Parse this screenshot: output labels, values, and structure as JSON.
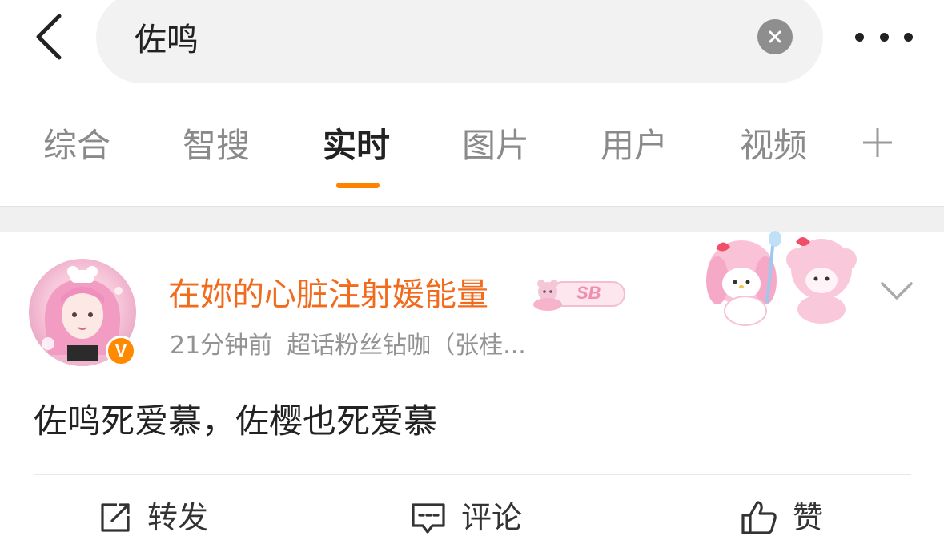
{
  "search": {
    "query": "佐鸣"
  },
  "tabs": [
    {
      "label": "综合"
    },
    {
      "label": "智搜"
    },
    {
      "label": "实时"
    },
    {
      "label": "图片"
    },
    {
      "label": "用户"
    },
    {
      "label": "视频"
    }
  ],
  "active_tab": "实时",
  "post": {
    "username": "在妳的心脏注射媛能量",
    "badge_text": "SB",
    "verified_mark": "V",
    "time": "21分钟前",
    "source": "超话粉丝钻咖（张桂...",
    "content": "佐鸣死爱慕，佐樱也死爱慕"
  },
  "actions": {
    "repost_label": "转发",
    "comment_label": "评论",
    "like_label": "赞"
  },
  "colors": {
    "accent": "#ff8200",
    "username": "#f26b1d",
    "verified": "#ff8a00"
  }
}
